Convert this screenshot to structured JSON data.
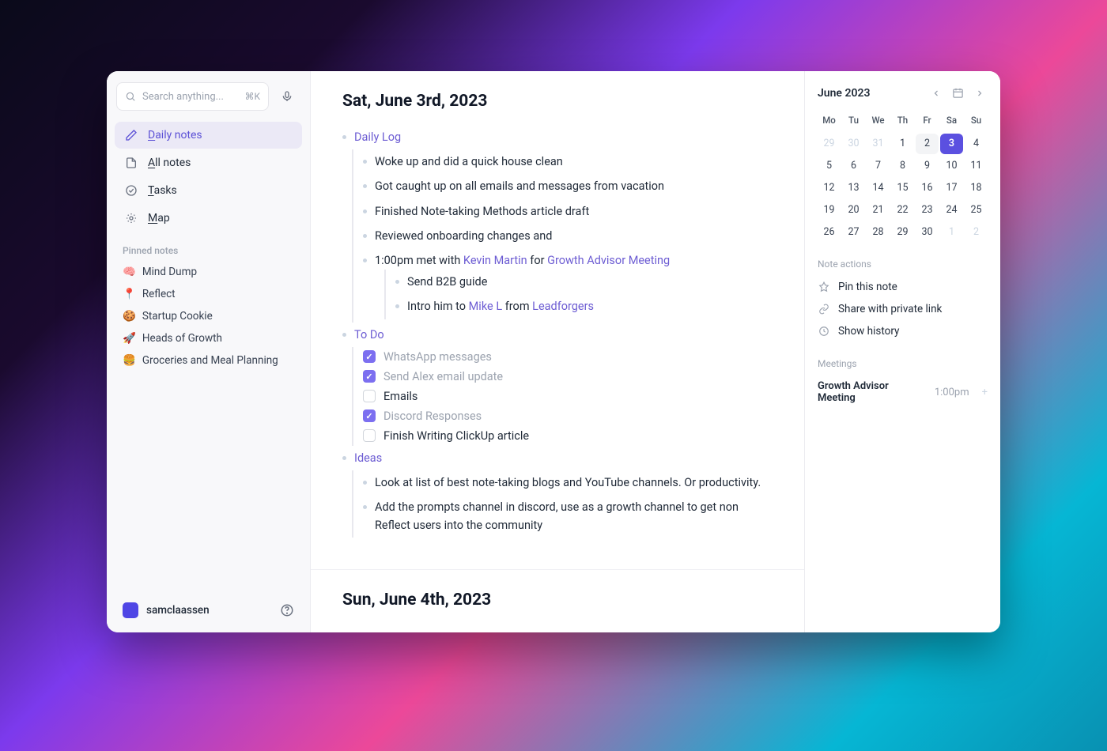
{
  "sidebar": {
    "search_placeholder": "Search anything...",
    "search_shortcut": "⌘K",
    "nav": [
      {
        "icon": "pencil",
        "label_html": "<span class='underline'>D</span>aily notes",
        "active": true
      },
      {
        "icon": "file",
        "label_html": "<span class='underline'>A</span>ll notes",
        "active": false
      },
      {
        "icon": "check",
        "label_html": "<span class='underline'>T</span>asks",
        "active": false
      },
      {
        "icon": "map",
        "label_html": "<span class='underline'>M</span>ap",
        "active": false
      }
    ],
    "pinned_label": "Pinned notes",
    "pinned": [
      {
        "emoji": "🧠",
        "label": "Mind Dump"
      },
      {
        "emoji": "📍",
        "label": "Reflect"
      },
      {
        "emoji": "🍪",
        "label": "Startup Cookie"
      },
      {
        "emoji": "🚀",
        "label": "Heads of Growth"
      },
      {
        "emoji": "🍔",
        "label": "Groceries and Meal Planning"
      }
    ],
    "username": "samclaassen"
  },
  "notes": [
    {
      "title": "Sat, June 3rd, 2023",
      "sections": [
        {
          "heading": "Daily Log",
          "items": [
            {
              "type": "text",
              "text": "Woke up and did a quick house clean"
            },
            {
              "type": "text",
              "text": "Got caught up on all emails and messages from vacation"
            },
            {
              "type": "text",
              "text": "Finished Note-taking Methods article draft"
            },
            {
              "type": "text",
              "text": "Reviewed onboarding changes and"
            },
            {
              "type": "rich",
              "parts": [
                {
                  "t": "1:00pm met with "
                },
                {
                  "t": "Kevin Martin",
                  "link": true
                },
                {
                  "t": " for "
                },
                {
                  "t": "Growth Advisor Meeting",
                  "link": true
                }
              ],
              "children": [
                {
                  "type": "text",
                  "text": "Send B2B guide"
                },
                {
                  "type": "rich",
                  "parts": [
                    {
                      "t": "Intro him to "
                    },
                    {
                      "t": "Mike L",
                      "link": true
                    },
                    {
                      "t": " from "
                    },
                    {
                      "t": "Leadforgers",
                      "link": true
                    }
                  ]
                }
              ]
            }
          ]
        },
        {
          "heading": "To Do",
          "items": [
            {
              "type": "todo",
              "done": true,
              "text": "WhatsApp messages"
            },
            {
              "type": "todo",
              "done": true,
              "text": "Send Alex email update"
            },
            {
              "type": "todo",
              "done": false,
              "text": "Emails"
            },
            {
              "type": "todo",
              "done": true,
              "text": "Discord Responses"
            },
            {
              "type": "todo",
              "done": false,
              "text": "Finish Writing ClickUp article"
            }
          ]
        },
        {
          "heading": "Ideas",
          "items": [
            {
              "type": "text",
              "text": "Look at list of best note-taking blogs and YouTube channels. Or productivity."
            },
            {
              "type": "text",
              "text": "Add the prompts channel in discord, use as a growth channel to get non Reflect users into the community"
            }
          ]
        }
      ]
    },
    {
      "title": "Sun, June 4th, 2023",
      "sections": []
    }
  ],
  "calendar": {
    "month_label": "June 2023",
    "dow": [
      "Mo",
      "Tu",
      "We",
      "Th",
      "Fr",
      "Sa",
      "Su"
    ],
    "weeks": [
      [
        {
          "n": 29,
          "muted": true
        },
        {
          "n": 30,
          "muted": true
        },
        {
          "n": 31,
          "muted": true
        },
        {
          "n": 1
        },
        {
          "n": 2,
          "hl": true
        },
        {
          "n": 3,
          "sel": true
        },
        {
          "n": 4
        }
      ],
      [
        {
          "n": 5
        },
        {
          "n": 6
        },
        {
          "n": 7
        },
        {
          "n": 8
        },
        {
          "n": 9
        },
        {
          "n": 10
        },
        {
          "n": 11
        }
      ],
      [
        {
          "n": 12
        },
        {
          "n": 13
        },
        {
          "n": 14
        },
        {
          "n": 15
        },
        {
          "n": 16
        },
        {
          "n": 17
        },
        {
          "n": 18
        }
      ],
      [
        {
          "n": 19
        },
        {
          "n": 20
        },
        {
          "n": 21
        },
        {
          "n": 22
        },
        {
          "n": 23
        },
        {
          "n": 24
        },
        {
          "n": 25
        }
      ],
      [
        {
          "n": 26
        },
        {
          "n": 27
        },
        {
          "n": 28
        },
        {
          "n": 29
        },
        {
          "n": 30
        },
        {
          "n": 1,
          "muted": true
        },
        {
          "n": 2,
          "muted": true
        }
      ]
    ]
  },
  "note_actions": {
    "label": "Note actions",
    "items": [
      {
        "icon": "pin",
        "label": "Pin this note"
      },
      {
        "icon": "link",
        "label": "Share with private link"
      },
      {
        "icon": "history",
        "label": "Show history"
      }
    ]
  },
  "meetings": {
    "label": "Meetings",
    "items": [
      {
        "name": "Growth Advisor Meeting",
        "time": "1:00pm"
      }
    ]
  }
}
